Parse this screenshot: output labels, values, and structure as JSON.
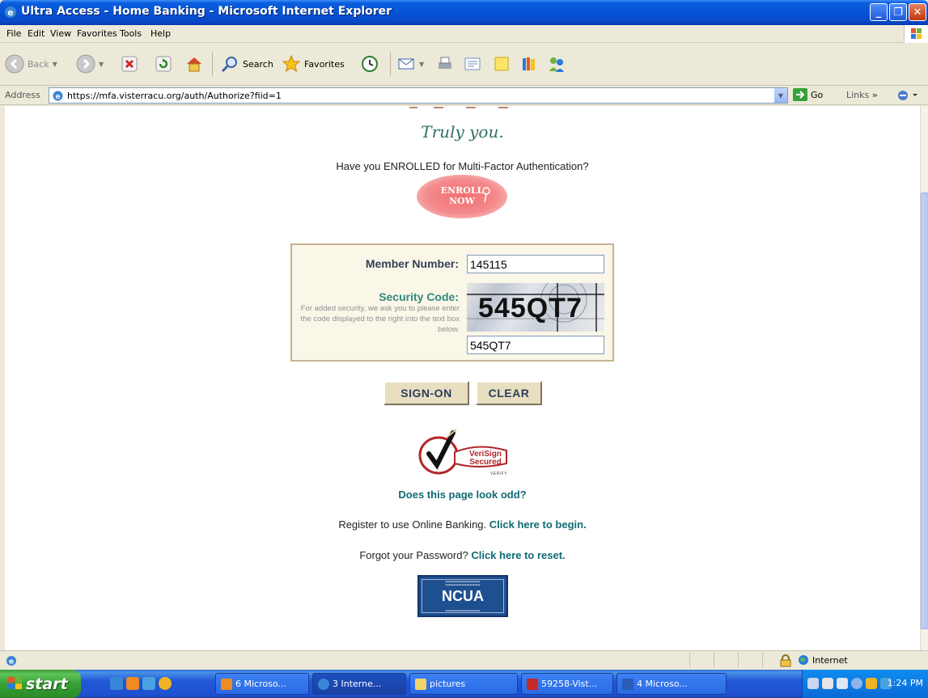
{
  "window": {
    "title": "Ultra Access - Home Banking - Microsoft Internet Explorer"
  },
  "menu": [
    "File",
    "Edit",
    "View",
    "Favorites",
    "Tools",
    "Help"
  ],
  "toolbar": {
    "back_label": "Back",
    "search_label": "Search",
    "favorites_label": "Favorites"
  },
  "address": {
    "label": "Address",
    "url": "https://mfa.visterracu.org/auth/Authorize?fiid=1",
    "go_label": "Go",
    "links_label": "Links"
  },
  "page": {
    "tagline": "Truly you.",
    "enroll_question": "Have you ENROLLED for Multi-Factor Authentication?",
    "enroll_button": {
      "line1": "ENROLL",
      "line2": "NOW"
    },
    "member_number_label": "Member Number:",
    "member_number_value": "145115",
    "security_code_label": "Security Code:",
    "security_code_help": "For added security, we ask you to please enter the code displayed to the right into the text box below.",
    "captcha_text": "545QT7",
    "security_code_value": "545QT7",
    "sign_on_button": "SIGN-ON",
    "clear_button": "CLEAR",
    "verisign": {
      "line1": "VeriSign",
      "line2": "Secured",
      "line3": "VERIFY"
    },
    "odd_link": "Does this page look odd?",
    "register_text": "Register to use Online Banking.",
    "register_link": "Click here to begin.",
    "forgot_text": "Forgot your Password?",
    "forgot_link": "Click here to reset.",
    "ncua_label": "NCUA"
  },
  "status": {
    "zone_label": "Internet"
  },
  "taskbar": {
    "start_label": "start",
    "tasks": [
      "6 Microso...",
      "3 Interne...",
      "pictures",
      "59258-Vist...",
      "4 Microso..."
    ],
    "clock": "1:24 PM"
  },
  "colors": {
    "accent_teal": "#0f6b73",
    "panel_border": "#c5b48e",
    "xp_blue": "#0653d6"
  }
}
